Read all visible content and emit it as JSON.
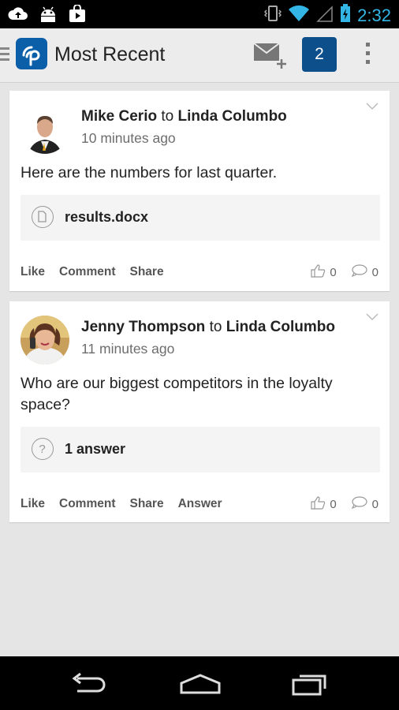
{
  "status_bar": {
    "time": "2:32",
    "icons": [
      "cloud-upload-icon",
      "android-icon",
      "shop-bag-icon",
      "vibrate-icon",
      "wifi-icon",
      "signal-icon",
      "battery-charging-icon"
    ]
  },
  "action_bar": {
    "title": "Most Recent",
    "notification_count": "2",
    "icons": [
      "menu-icon",
      "app-logo-icon",
      "new-message-icon",
      "overflow-menu-icon"
    ]
  },
  "feed": [
    {
      "author": "Mike Cerio",
      "to_word": "to",
      "recipient": "Linda Columbo",
      "time": "10 minutes ago",
      "text": "Here are the numbers for last quarter.",
      "attachment": {
        "icon": "document-icon",
        "label": "results.docx"
      },
      "actions": [
        "Like",
        "Comment",
        "Share"
      ],
      "likes": "0",
      "comments": "0"
    },
    {
      "author": "Jenny Thompson",
      "to_word": "to",
      "recipient": "Linda Columbo",
      "time": "11 minutes ago",
      "text": "Who are our biggest competitors in the loyalty space?",
      "attachment": {
        "icon": "question-icon",
        "label": "1 answer"
      },
      "actions": [
        "Like",
        "Comment",
        "Share",
        "Answer"
      ],
      "likes": "0",
      "comments": "0"
    }
  ],
  "colors": {
    "brand_blue": "#0a5fa8",
    "badge_blue": "#0d4f8b",
    "status_time": "#33b5e5",
    "background": "#e5e5e5"
  },
  "nav_bar": {
    "icons": [
      "back-icon",
      "home-icon",
      "recents-icon"
    ]
  }
}
